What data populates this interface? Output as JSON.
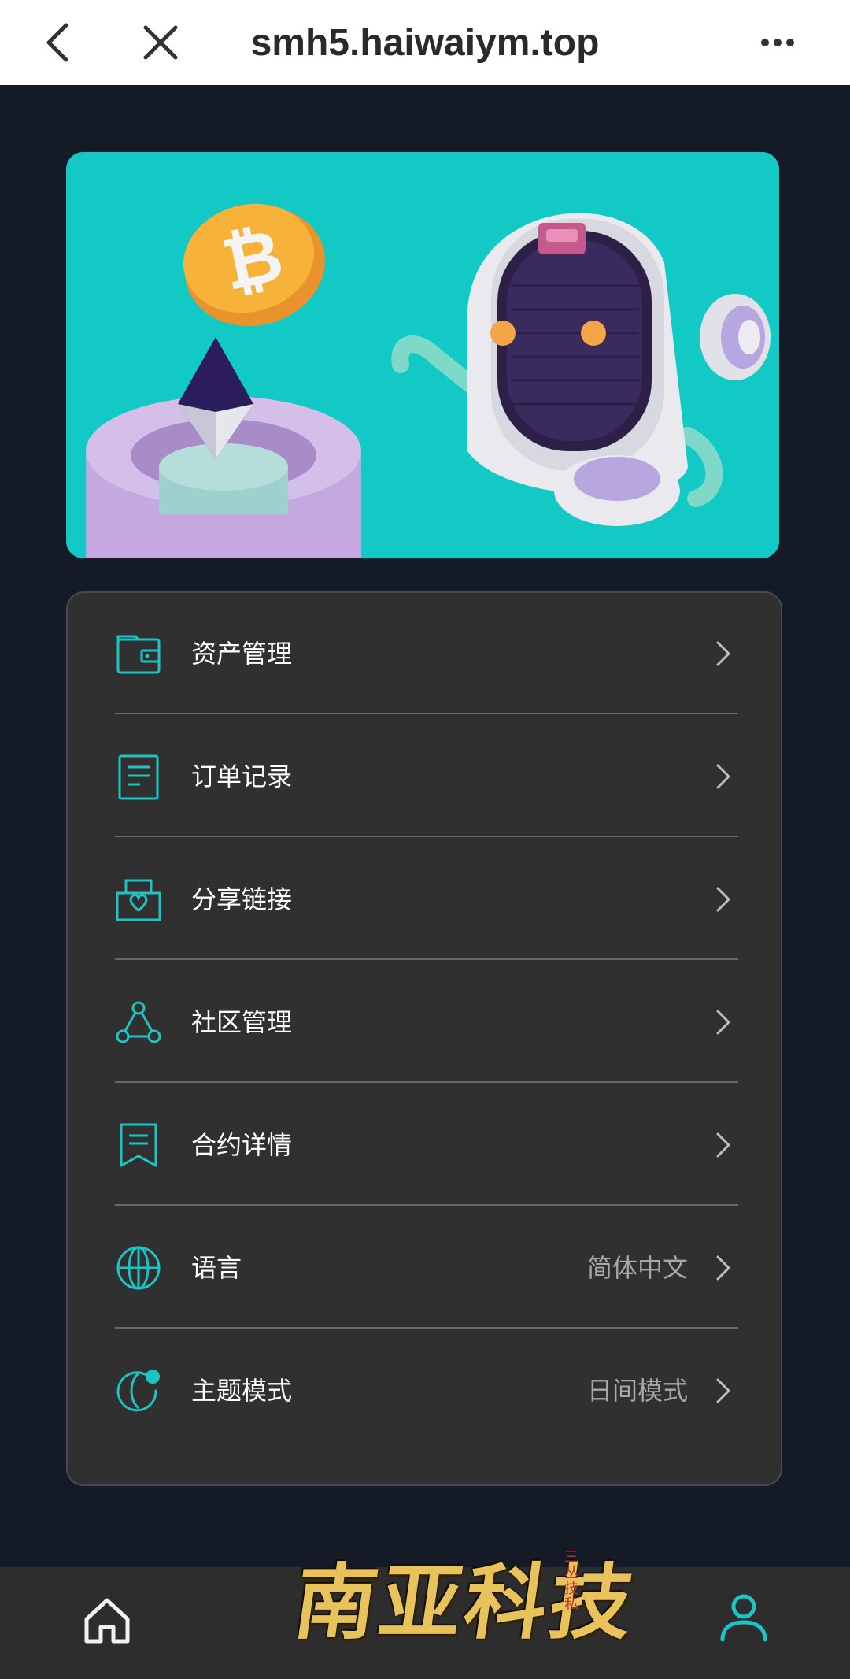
{
  "browser": {
    "url": "smh5.haiwaiym.top",
    "back_icon": "chevron-left-icon",
    "close_icon": "close-icon",
    "more_icon": "more-horizontal-icon"
  },
  "banner": {
    "bg_color": "#12c9c6"
  },
  "menu": {
    "items": [
      {
        "label": "资产管理",
        "icon": "wallet-icon",
        "value": ""
      },
      {
        "label": "订单记录",
        "icon": "document-icon",
        "value": ""
      },
      {
        "label": "分享链接",
        "icon": "share-heart-icon",
        "value": ""
      },
      {
        "label": "社区管理",
        "icon": "community-icon",
        "value": ""
      },
      {
        "label": "合约详情",
        "icon": "contract-icon",
        "value": ""
      },
      {
        "label": "语言",
        "icon": "globe-icon",
        "value": "简体中文"
      },
      {
        "label": "主题模式",
        "icon": "theme-icon",
        "value": "日间模式"
      }
    ]
  },
  "bottom_nav": {
    "home_icon": "home-icon",
    "user_icon": "user-icon"
  },
  "watermark": {
    "text": "南亚科技",
    "seal": "三丛技私"
  },
  "colors": {
    "accent": "#1fc3c3",
    "page_bg": "#141a26",
    "card_bg": "#303030"
  }
}
